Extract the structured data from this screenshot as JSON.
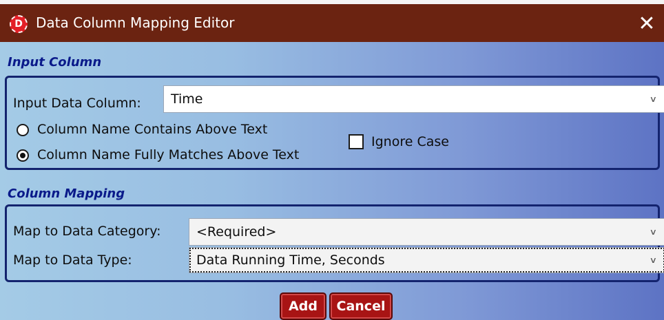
{
  "window": {
    "title": "Data Column Mapping Editor",
    "icon_letter": "D",
    "close_symbol": "✕"
  },
  "input_section": {
    "heading": "Input Column",
    "input_data_column_label": "Input Data Column:",
    "input_data_column_value": "Time",
    "radio_contains_label": "Column Name Contains Above Text",
    "radio_contains_checked": false,
    "radio_fully_matches_label": "Column Name Fully Matches Above Text",
    "radio_fully_matches_checked": true,
    "ignore_case_label": "Ignore Case",
    "ignore_case_checked": false
  },
  "mapping_section": {
    "heading": "Column Mapping",
    "category_label": "Map to Data Category:",
    "category_value": "<Required>",
    "type_label": "Map to Data Type:",
    "type_value": "Data Running Time, Seconds"
  },
  "buttons": {
    "add": "Add",
    "cancel": "Cancel"
  },
  "icons": {
    "dropdown": "chevron-down-icon",
    "close": "close-icon",
    "app": "app-logo-icon"
  },
  "colors": {
    "titlebar": "#6b2311",
    "section_heading": "#0a1a8a",
    "button": "#a81414"
  }
}
